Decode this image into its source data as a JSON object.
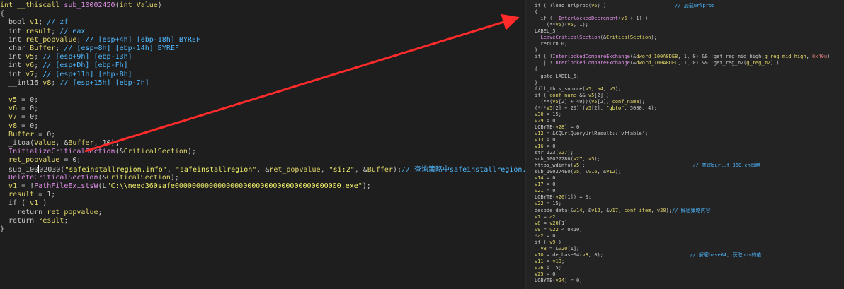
{
  "colors": {
    "background": "#1e1e1e",
    "arrow": "#ff2a2a",
    "keyword": "#c8c8c8",
    "identifier": "#e0d56a",
    "function": "#e090e8",
    "string": "#f0ee6a",
    "comment": "#4fb8ff"
  },
  "left_code": [
    [
      [
        "ty",
        "int __thiscall "
      ],
      [
        "fn",
        "sub_10002450"
      ],
      [
        "pl",
        "("
      ],
      [
        "ty",
        "int"
      ],
      [
        "pl",
        " "
      ],
      [
        "vr",
        "Value"
      ],
      [
        "pl",
        ")"
      ]
    ],
    [
      [
        "pl",
        "{"
      ]
    ],
    [
      [
        "pl",
        "  bool "
      ],
      [
        "vr",
        "v1"
      ],
      [
        "pl",
        "; "
      ],
      [
        "cm",
        "// zf"
      ]
    ],
    [
      [
        "pl",
        "  int "
      ],
      [
        "vr",
        "result"
      ],
      [
        "pl",
        "; "
      ],
      [
        "cm",
        "// eax"
      ]
    ],
    [
      [
        "pl",
        "  int "
      ],
      [
        "vr",
        "ret_popvalue"
      ],
      [
        "pl",
        "; "
      ],
      [
        "cm",
        "// [esp+4h] [ebp-18h] BYREF"
      ]
    ],
    [
      [
        "pl",
        "  char "
      ],
      [
        "vr",
        "Buffer"
      ],
      [
        "pl",
        "; "
      ],
      [
        "cm",
        "// [esp+8h] [ebp-14h] BYREF"
      ]
    ],
    [
      [
        "pl",
        "  int "
      ],
      [
        "vr",
        "v5"
      ],
      [
        "pl",
        "; "
      ],
      [
        "cm",
        "// [esp+9h] [ebp-13h]"
      ]
    ],
    [
      [
        "pl",
        "  int "
      ],
      [
        "vr",
        "v6"
      ],
      [
        "pl",
        "; "
      ],
      [
        "cm",
        "// [esp+Dh] [ebp-Fh]"
      ]
    ],
    [
      [
        "pl",
        "  int "
      ],
      [
        "vr",
        "v7"
      ],
      [
        "pl",
        "; "
      ],
      [
        "cm",
        "// [esp+11h] [ebp-Bh]"
      ]
    ],
    [
      [
        "pl",
        "  __int16 "
      ],
      [
        "vr",
        "v8"
      ],
      [
        "pl",
        "; "
      ],
      [
        "cm",
        "// [esp+15h] [ebp-7h]"
      ]
    ],
    [
      [
        "pl",
        ""
      ]
    ],
    [
      [
        "pl",
        "  "
      ],
      [
        "vr",
        "v5"
      ],
      [
        "pl",
        " = 0;"
      ]
    ],
    [
      [
        "pl",
        "  "
      ],
      [
        "vr",
        "v6"
      ],
      [
        "pl",
        " = 0;"
      ]
    ],
    [
      [
        "pl",
        "  "
      ],
      [
        "vr",
        "v7"
      ],
      [
        "pl",
        " = 0;"
      ]
    ],
    [
      [
        "pl",
        "  "
      ],
      [
        "vr",
        "v8"
      ],
      [
        "pl",
        " = 0;"
      ]
    ],
    [
      [
        "pl",
        "  "
      ],
      [
        "vr",
        "Buffer"
      ],
      [
        "pl",
        " = 0;"
      ]
    ],
    [
      [
        "pl",
        "  _itoa("
      ],
      [
        "vr",
        "Value"
      ],
      [
        "pl",
        ", &"
      ],
      [
        "vr",
        "Buffer"
      ],
      [
        "pl",
        ", 10);"
      ]
    ],
    [
      [
        "pl",
        "  "
      ],
      [
        "fn",
        "InitializeCriticalSection"
      ],
      [
        "pl",
        "(&"
      ],
      [
        "vr",
        "CriticalSection"
      ],
      [
        "pl",
        ");"
      ]
    ],
    [
      [
        "pl",
        "  "
      ],
      [
        "vr",
        "ret_popvalue"
      ],
      [
        "pl",
        " = 0;"
      ]
    ],
    [
      [
        "pl",
        "  sub_100"
      ],
      [
        "caret",
        ""
      ],
      [
        "pl",
        "02030("
      ],
      [
        "st",
        "\"safeinstallregion.info\""
      ],
      [
        "pl",
        ", "
      ],
      [
        "st",
        "\"safeinstallregion\""
      ],
      [
        "pl",
        ", &"
      ],
      [
        "vr",
        "ret_popvalue"
      ],
      [
        "pl",
        ", "
      ],
      [
        "st",
        "\"si:2\""
      ],
      [
        "pl",
        ", &"
      ],
      [
        "vr",
        "Buffer"
      ],
      [
        "pl",
        ");"
      ],
      [
        "cm",
        "// 查询策略中safeinstallregion.info值"
      ]
    ],
    [
      [
        "pl",
        "  "
      ],
      [
        "fn",
        "DeleteCriticalSection"
      ],
      [
        "pl",
        "(&"
      ],
      [
        "vr",
        "CriticalSection"
      ],
      [
        "pl",
        ");"
      ]
    ],
    [
      [
        "pl",
        "  "
      ],
      [
        "vr",
        "v1"
      ],
      [
        "pl",
        " = !"
      ],
      [
        "fn",
        "PathFileExistsW"
      ],
      [
        "pl",
        "(L"
      ],
      [
        "st",
        "\"C:\\\\need360safe000000000000000000000000000000000000000.exe\""
      ],
      [
        "pl",
        ");"
      ]
    ],
    [
      [
        "pl",
        "  "
      ],
      [
        "vr",
        "result"
      ],
      [
        "pl",
        " = 1;"
      ]
    ],
    [
      [
        "pl",
        "  if ( "
      ],
      [
        "vr",
        "v1"
      ],
      [
        "pl",
        " )"
      ]
    ],
    [
      [
        "pl",
        "    return "
      ],
      [
        "vr",
        "ret_popvalue"
      ],
      [
        "pl",
        ";"
      ]
    ],
    [
      [
        "pl",
        "  return "
      ],
      [
        "vr",
        "result"
      ],
      [
        "pl",
        ";"
      ]
    ],
    [
      [
        "pl",
        "}"
      ]
    ]
  ],
  "right_code": [
    [
      [
        "pl",
        "if ( !"
      ],
      [
        "pl",
        "load_urlproc"
      ],
      [
        "pl",
        "("
      ],
      [
        "vr",
        "v5"
      ],
      [
        "pl",
        ") )                       "
      ],
      [
        "cm",
        "// 加载urlproc"
      ]
    ],
    [
      [
        "pl",
        "{"
      ]
    ],
    [
      [
        "pl",
        "  if ( !"
      ],
      [
        "fn",
        "InterlockedDecrement"
      ],
      [
        "pl",
        "("
      ],
      [
        "vr",
        "v5"
      ],
      [
        "pl",
        " + 1) )"
      ]
    ],
    [
      [
        "pl",
        "    (**"
      ],
      [
        "vr",
        "v5"
      ],
      [
        "pl",
        ")("
      ],
      [
        "vr",
        "v5"
      ],
      [
        "pl",
        ", 1);"
      ]
    ],
    [
      [
        "lab",
        "LABEL_5:"
      ]
    ],
    [
      [
        "pl",
        "  "
      ],
      [
        "fn",
        "LeaveCriticalSection"
      ],
      [
        "pl",
        "(&"
      ],
      [
        "vr",
        "CriticalSection"
      ],
      [
        "pl",
        ");"
      ]
    ],
    [
      [
        "pl",
        "  return 0;"
      ]
    ],
    [
      [
        "pl",
        "}"
      ]
    ],
    [
      [
        "pl",
        "if ( !"
      ],
      [
        "fn",
        "InterlockedCompareExchange"
      ],
      [
        "pl",
        "(&"
      ],
      [
        "vr",
        "dword_100A8DE8"
      ],
      [
        "pl",
        ", 1, 0) && !"
      ],
      [
        "pl",
        "get_reg_mid_high"
      ],
      [
        "pl",
        "("
      ],
      [
        "vr",
        "g_reg_mid_high"
      ],
      [
        "pl",
        ", "
      ],
      [
        "cn",
        "0x40u"
      ],
      [
        "pl",
        ")"
      ]
    ],
    [
      [
        "pl",
        "  || !"
      ],
      [
        "fn",
        "InterlockedCompareExchange"
      ],
      [
        "pl",
        "(&"
      ],
      [
        "vr",
        "dword_100A8DEC"
      ],
      [
        "pl",
        ", 1, 0) && !"
      ],
      [
        "pl",
        "get_reg_m2"
      ],
      [
        "pl",
        "("
      ],
      [
        "vr",
        "g_reg_m2"
      ],
      [
        "pl",
        ") )"
      ]
    ],
    [
      [
        "pl",
        "{"
      ]
    ],
    [
      [
        "pl",
        "  goto LABEL_5;"
      ]
    ],
    [
      [
        "pl",
        "}"
      ]
    ],
    [
      [
        "pl",
        "fill_this_source("
      ],
      [
        "vr",
        "v5"
      ],
      [
        "pl",
        ", "
      ],
      [
        "vr",
        "a4"
      ],
      [
        "pl",
        ", "
      ],
      [
        "vr",
        "v5"
      ],
      [
        "pl",
        ");"
      ]
    ],
    [
      [
        "pl",
        "if ( "
      ],
      [
        "vr",
        "conf_name"
      ],
      [
        "pl",
        " && "
      ],
      [
        "vr",
        "v5"
      ],
      [
        "pl",
        "[2] )"
      ]
    ],
    [
      [
        "pl",
        "  (**("
      ],
      [
        "vr",
        "v5"
      ],
      [
        "pl",
        "[2] + 40))("
      ],
      [
        "vr",
        "v5"
      ],
      [
        "pl",
        "[2], "
      ],
      [
        "vr",
        "conf_name"
      ],
      [
        "pl",
        ");"
      ]
    ],
    [
      [
        "pl",
        "(*(*"
      ],
      [
        "vr",
        "v5"
      ],
      [
        "pl",
        "[2] + 20))("
      ],
      [
        "vr",
        "v5"
      ],
      [
        "pl",
        "[2], "
      ],
      [
        "st",
        "\"qbto\""
      ],
      [
        "pl",
        ", 5000, 4);"
      ]
    ],
    [
      [
        "vr",
        "v30"
      ],
      [
        "pl",
        " = 15;"
      ]
    ],
    [
      [
        "vr",
        "v29"
      ],
      [
        "pl",
        " = 0;"
      ]
    ],
    [
      [
        "pl",
        "LOBYTE("
      ],
      [
        "vr",
        "v28"
      ],
      [
        "pl",
        ") = 0;"
      ]
    ],
    [
      [
        "vr",
        "v12"
      ],
      [
        "pl",
        " = &CQUrlQueryUrlResult::`vftable';"
      ]
    ],
    [
      [
        "vr",
        "v13"
      ],
      [
        "pl",
        " = 0;"
      ]
    ],
    [
      [
        "vr",
        "v16"
      ],
      [
        "pl",
        " = 0;"
      ]
    ],
    [
      [
        "pl",
        "str_123("
      ],
      [
        "vr",
        "v27"
      ],
      [
        "pl",
        ");"
      ]
    ],
    [
      [
        "pl",
        "sub_10027280("
      ],
      [
        "vr",
        "v27"
      ],
      [
        "pl",
        ", "
      ],
      [
        "vr",
        "v5"
      ],
      [
        "pl",
        ");"
      ]
    ],
    [
      [
        "pl",
        "https_wdinfo("
      ],
      [
        "vr",
        "v5"
      ],
      [
        "pl",
        ");                                    "
      ],
      [
        "cm",
        "// 查询qurl.f.360.cn策略"
      ]
    ],
    [
      [
        "pl",
        "sub_100274E0("
      ],
      [
        "vr",
        "v5"
      ],
      [
        "pl",
        ", &"
      ],
      [
        "vr",
        "v16"
      ],
      [
        "pl",
        ", &"
      ],
      [
        "vr",
        "v12"
      ],
      [
        "pl",
        ");"
      ]
    ],
    [
      [
        "vr",
        "v14"
      ],
      [
        "pl",
        " = 0;"
      ]
    ],
    [
      [
        "vr",
        "v17"
      ],
      [
        "pl",
        " = 0;"
      ]
    ],
    [
      [
        "vr",
        "v21"
      ],
      [
        "pl",
        " = 0;"
      ]
    ],
    [
      [
        "pl",
        "LOBYTE("
      ],
      [
        "vr",
        "v20"
      ],
      [
        "pl",
        "[1]) = 0;"
      ]
    ],
    [
      [
        "vr",
        "v22"
      ],
      [
        "pl",
        " = 15;"
      ]
    ],
    [
      [
        "pl",
        "decode_data(&"
      ],
      [
        "vr",
        "v14"
      ],
      [
        "pl",
        ", &"
      ],
      [
        "vr",
        "v12"
      ],
      [
        "pl",
        ", &"
      ],
      [
        "vr",
        "v17"
      ],
      [
        "pl",
        ", "
      ],
      [
        "vr",
        "conf_item"
      ],
      [
        "pl",
        ", "
      ],
      [
        "vr",
        "v20"
      ],
      [
        "pl",
        ");"
      ],
      [
        "cm",
        "// 解密策略内容"
      ]
    ],
    [
      [
        "vr",
        "v7"
      ],
      [
        "pl",
        " = "
      ],
      [
        "vr",
        "a2"
      ],
      [
        "pl",
        ";"
      ]
    ],
    [
      [
        "vr",
        "v8"
      ],
      [
        "pl",
        " = "
      ],
      [
        "vr",
        "v20"
      ],
      [
        "pl",
        "[1];"
      ]
    ],
    [
      [
        "vr",
        "v9"
      ],
      [
        "pl",
        " = "
      ],
      [
        "vr",
        "v22"
      ],
      [
        "pl",
        " < 0x10;"
      ]
    ],
    [
      [
        "pl",
        "*"
      ],
      [
        "vr",
        "a2"
      ],
      [
        "pl",
        " = 0;"
      ]
    ],
    [
      [
        "pl",
        "if ( "
      ],
      [
        "vr",
        "v9"
      ],
      [
        "pl",
        " )"
      ]
    ],
    [
      [
        "pl",
        "  "
      ],
      [
        "vr",
        "v8"
      ],
      [
        "pl",
        " = &"
      ],
      [
        "vr",
        "v20"
      ],
      [
        "pl",
        "[1];"
      ]
    ],
    [
      [
        "vr",
        "v10"
      ],
      [
        "pl",
        " = de_base64("
      ],
      [
        "vr",
        "v8"
      ],
      [
        "pl",
        ", 0);                             "
      ],
      [
        "cm",
        "// 解密base64, 获取pos的值"
      ]
    ],
    [
      [
        "vr",
        "v11"
      ],
      [
        "pl",
        " = "
      ],
      [
        "vr",
        "v10"
      ],
      [
        "pl",
        ";"
      ]
    ],
    [
      [
        "vr",
        "v26"
      ],
      [
        "pl",
        " = 15;"
      ]
    ],
    [
      [
        "vr",
        "v25"
      ],
      [
        "pl",
        " = 0;"
      ]
    ],
    [
      [
        "pl",
        "LOBYTE("
      ],
      [
        "vr",
        "v24"
      ],
      [
        "pl",
        ") = 0;"
      ]
    ]
  ]
}
